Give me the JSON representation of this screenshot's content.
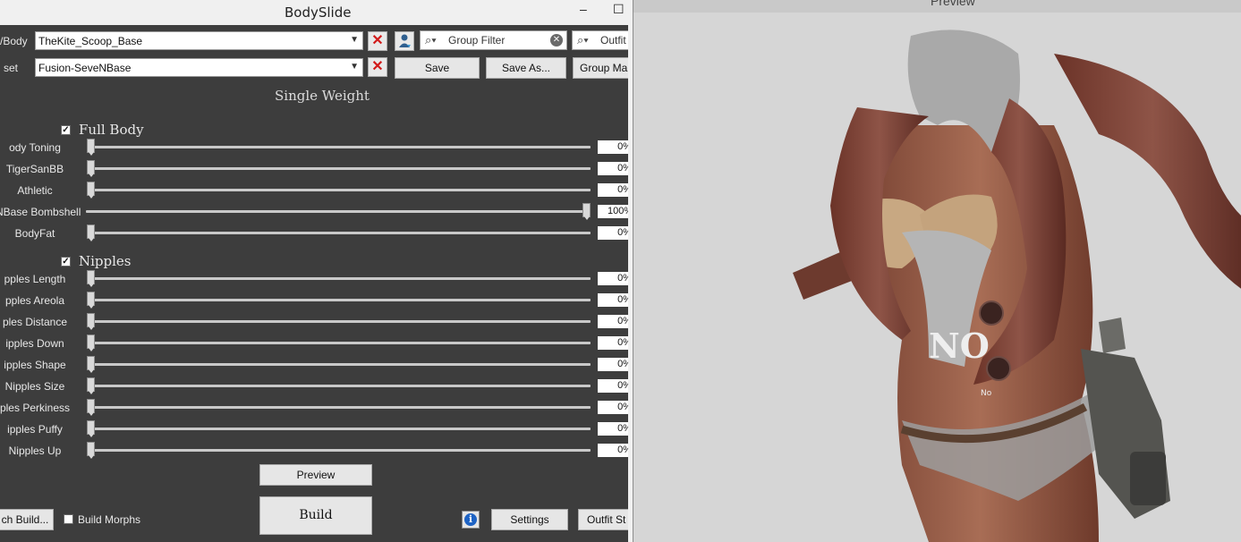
{
  "window_title": "BodySlide",
  "window_controls": {
    "minimize": "–",
    "maximize": "☐"
  },
  "outfit_label": "/Body",
  "outfit_value": "TheKite_Scoop_Base",
  "preset_label": "set",
  "preset_value": "Fusion-SeveNBase",
  "group_filter_placeholder": "Group Filter",
  "outfit_filter_placeholder": "Outfit",
  "buttons": {
    "save": "Save",
    "save_as": "Save As...",
    "group_manager": "Group Ma",
    "preview": "Preview",
    "build": "Build",
    "batch_build": "ch Build...",
    "settings": "Settings",
    "outfit_studio": "Outfit St"
  },
  "single_weight": "Single Weight",
  "groups": [
    {
      "label": "Full Body",
      "checked": true,
      "sliders": [
        {
          "label": "ody Toning",
          "value": "0%",
          "level": 0
        },
        {
          "label": "TigerSanBB",
          "value": "0%",
          "level": 0
        },
        {
          "label": "Athletic",
          "value": "0%",
          "level": 0
        },
        {
          "label": "NBase Bombshell",
          "value": "100%",
          "level": 100
        },
        {
          "label": "BodyFat",
          "value": "0%",
          "level": 0
        }
      ]
    },
    {
      "label": "Nipples",
      "checked": true,
      "sliders": [
        {
          "label": "pples Length",
          "value": "0%",
          "level": 0
        },
        {
          "label": "pples Areola",
          "value": "0%",
          "level": 0
        },
        {
          "label": "ples Distance",
          "value": "0%",
          "level": 0
        },
        {
          "label": "ipples Down",
          "value": "0%",
          "level": 0
        },
        {
          "label": "ipples Shape",
          "value": "0%",
          "level": 0
        },
        {
          "label": "Nipples Size",
          "value": "0%",
          "level": 0
        },
        {
          "label": "ples Perkiness",
          "value": "0%",
          "level": 0
        },
        {
          "label": "ipples Puffy",
          "value": "0%",
          "level": 0
        },
        {
          "label": "Nipples Up",
          "value": "0%",
          "level": 0
        }
      ]
    }
  ],
  "build_morphs": "Build Morphs",
  "build_morphs_checked": false,
  "preview_title": "Preview",
  "preview_decals": [
    "NO",
    "No"
  ]
}
